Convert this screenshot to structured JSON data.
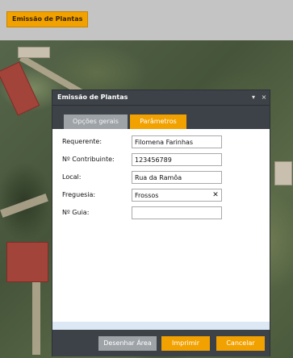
{
  "topbar": {
    "button_label": "Emissão de Plantas"
  },
  "dialog": {
    "title": "Emissão de Plantas",
    "header_tools": [
      "pin-icon",
      "close-icon"
    ],
    "tabs": [
      {
        "label": "Opções gerais",
        "active": false
      },
      {
        "label": "Parâmetros",
        "active": true
      }
    ],
    "fields": {
      "requerente": {
        "label": "Requerente:",
        "value": "Filomena Farinhas"
      },
      "contribuinte": {
        "label": "Nº Contribuinte:",
        "value": "123456789"
      },
      "local": {
        "label": "Local:",
        "value": "Rua da Ramôa"
      },
      "freguesia": {
        "label": "Freguesia:",
        "value": "Frossos"
      },
      "guia": {
        "label": "Nº Guia:",
        "value": ""
      }
    },
    "footer": {
      "draw_area_label": "Desenhar Área",
      "print_label": "Imprimir",
      "cancel_label": "Cancelar"
    }
  },
  "colors": {
    "accent": "#f2a200",
    "dialog_header": "#3d4248",
    "inactive_tab": "#9ea3a8",
    "footer_strip": "#dce9f5"
  }
}
